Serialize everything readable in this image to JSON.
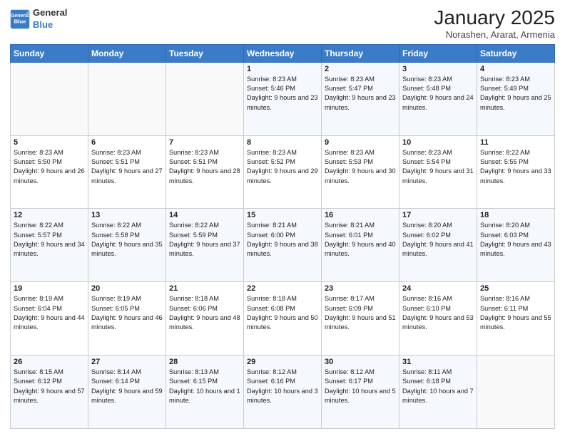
{
  "logo": {
    "line1": "General",
    "line2": "Blue",
    "tagline": ""
  },
  "header": {
    "month": "January 2025",
    "location": "Norashen, Ararat, Armenia"
  },
  "weekdays": [
    "Sunday",
    "Monday",
    "Tuesday",
    "Wednesday",
    "Thursday",
    "Friday",
    "Saturday"
  ],
  "weeks": [
    [
      {
        "day": "",
        "sunrise": "",
        "sunset": "",
        "daylight": ""
      },
      {
        "day": "",
        "sunrise": "",
        "sunset": "",
        "daylight": ""
      },
      {
        "day": "",
        "sunrise": "",
        "sunset": "",
        "daylight": ""
      },
      {
        "day": "1",
        "sunrise": "Sunrise: 8:23 AM",
        "sunset": "Sunset: 5:46 PM",
        "daylight": "Daylight: 9 hours and 23 minutes."
      },
      {
        "day": "2",
        "sunrise": "Sunrise: 8:23 AM",
        "sunset": "Sunset: 5:47 PM",
        "daylight": "Daylight: 9 hours and 23 minutes."
      },
      {
        "day": "3",
        "sunrise": "Sunrise: 8:23 AM",
        "sunset": "Sunset: 5:48 PM",
        "daylight": "Daylight: 9 hours and 24 minutes."
      },
      {
        "day": "4",
        "sunrise": "Sunrise: 8:23 AM",
        "sunset": "Sunset: 5:49 PM",
        "daylight": "Daylight: 9 hours and 25 minutes."
      }
    ],
    [
      {
        "day": "5",
        "sunrise": "Sunrise: 8:23 AM",
        "sunset": "Sunset: 5:50 PM",
        "daylight": "Daylight: 9 hours and 26 minutes."
      },
      {
        "day": "6",
        "sunrise": "Sunrise: 8:23 AM",
        "sunset": "Sunset: 5:51 PM",
        "daylight": "Daylight: 9 hours and 27 minutes."
      },
      {
        "day": "7",
        "sunrise": "Sunrise: 8:23 AM",
        "sunset": "Sunset: 5:51 PM",
        "daylight": "Daylight: 9 hours and 28 minutes."
      },
      {
        "day": "8",
        "sunrise": "Sunrise: 8:23 AM",
        "sunset": "Sunset: 5:52 PM",
        "daylight": "Daylight: 9 hours and 29 minutes."
      },
      {
        "day": "9",
        "sunrise": "Sunrise: 8:23 AM",
        "sunset": "Sunset: 5:53 PM",
        "daylight": "Daylight: 9 hours and 30 minutes."
      },
      {
        "day": "10",
        "sunrise": "Sunrise: 8:23 AM",
        "sunset": "Sunset: 5:54 PM",
        "daylight": "Daylight: 9 hours and 31 minutes."
      },
      {
        "day": "11",
        "sunrise": "Sunrise: 8:22 AM",
        "sunset": "Sunset: 5:55 PM",
        "daylight": "Daylight: 9 hours and 33 minutes."
      }
    ],
    [
      {
        "day": "12",
        "sunrise": "Sunrise: 8:22 AM",
        "sunset": "Sunset: 5:57 PM",
        "daylight": "Daylight: 9 hours and 34 minutes."
      },
      {
        "day": "13",
        "sunrise": "Sunrise: 8:22 AM",
        "sunset": "Sunset: 5:58 PM",
        "daylight": "Daylight: 9 hours and 35 minutes."
      },
      {
        "day": "14",
        "sunrise": "Sunrise: 8:22 AM",
        "sunset": "Sunset: 5:59 PM",
        "daylight": "Daylight: 9 hours and 37 minutes."
      },
      {
        "day": "15",
        "sunrise": "Sunrise: 8:21 AM",
        "sunset": "Sunset: 6:00 PM",
        "daylight": "Daylight: 9 hours and 38 minutes."
      },
      {
        "day": "16",
        "sunrise": "Sunrise: 8:21 AM",
        "sunset": "Sunset: 6:01 PM",
        "daylight": "Daylight: 9 hours and 40 minutes."
      },
      {
        "day": "17",
        "sunrise": "Sunrise: 8:20 AM",
        "sunset": "Sunset: 6:02 PM",
        "daylight": "Daylight: 9 hours and 41 minutes."
      },
      {
        "day": "18",
        "sunrise": "Sunrise: 8:20 AM",
        "sunset": "Sunset: 6:03 PM",
        "daylight": "Daylight: 9 hours and 43 minutes."
      }
    ],
    [
      {
        "day": "19",
        "sunrise": "Sunrise: 8:19 AM",
        "sunset": "Sunset: 6:04 PM",
        "daylight": "Daylight: 9 hours and 44 minutes."
      },
      {
        "day": "20",
        "sunrise": "Sunrise: 8:19 AM",
        "sunset": "Sunset: 6:05 PM",
        "daylight": "Daylight: 9 hours and 46 minutes."
      },
      {
        "day": "21",
        "sunrise": "Sunrise: 8:18 AM",
        "sunset": "Sunset: 6:06 PM",
        "daylight": "Daylight: 9 hours and 48 minutes."
      },
      {
        "day": "22",
        "sunrise": "Sunrise: 8:18 AM",
        "sunset": "Sunset: 6:08 PM",
        "daylight": "Daylight: 9 hours and 50 minutes."
      },
      {
        "day": "23",
        "sunrise": "Sunrise: 8:17 AM",
        "sunset": "Sunset: 6:09 PM",
        "daylight": "Daylight: 9 hours and 51 minutes."
      },
      {
        "day": "24",
        "sunrise": "Sunrise: 8:16 AM",
        "sunset": "Sunset: 6:10 PM",
        "daylight": "Daylight: 9 hours and 53 minutes."
      },
      {
        "day": "25",
        "sunrise": "Sunrise: 8:16 AM",
        "sunset": "Sunset: 6:11 PM",
        "daylight": "Daylight: 9 hours and 55 minutes."
      }
    ],
    [
      {
        "day": "26",
        "sunrise": "Sunrise: 8:15 AM",
        "sunset": "Sunset: 6:12 PM",
        "daylight": "Daylight: 9 hours and 57 minutes."
      },
      {
        "day": "27",
        "sunrise": "Sunrise: 8:14 AM",
        "sunset": "Sunset: 6:14 PM",
        "daylight": "Daylight: 9 hours and 59 minutes."
      },
      {
        "day": "28",
        "sunrise": "Sunrise: 8:13 AM",
        "sunset": "Sunset: 6:15 PM",
        "daylight": "Daylight: 10 hours and 1 minute."
      },
      {
        "day": "29",
        "sunrise": "Sunrise: 8:12 AM",
        "sunset": "Sunset: 6:16 PM",
        "daylight": "Daylight: 10 hours and 3 minutes."
      },
      {
        "day": "30",
        "sunrise": "Sunrise: 8:12 AM",
        "sunset": "Sunset: 6:17 PM",
        "daylight": "Daylight: 10 hours and 5 minutes."
      },
      {
        "day": "31",
        "sunrise": "Sunrise: 8:11 AM",
        "sunset": "Sunset: 6:18 PM",
        "daylight": "Daylight: 10 hours and 7 minutes."
      },
      {
        "day": "",
        "sunrise": "",
        "sunset": "",
        "daylight": ""
      }
    ]
  ]
}
